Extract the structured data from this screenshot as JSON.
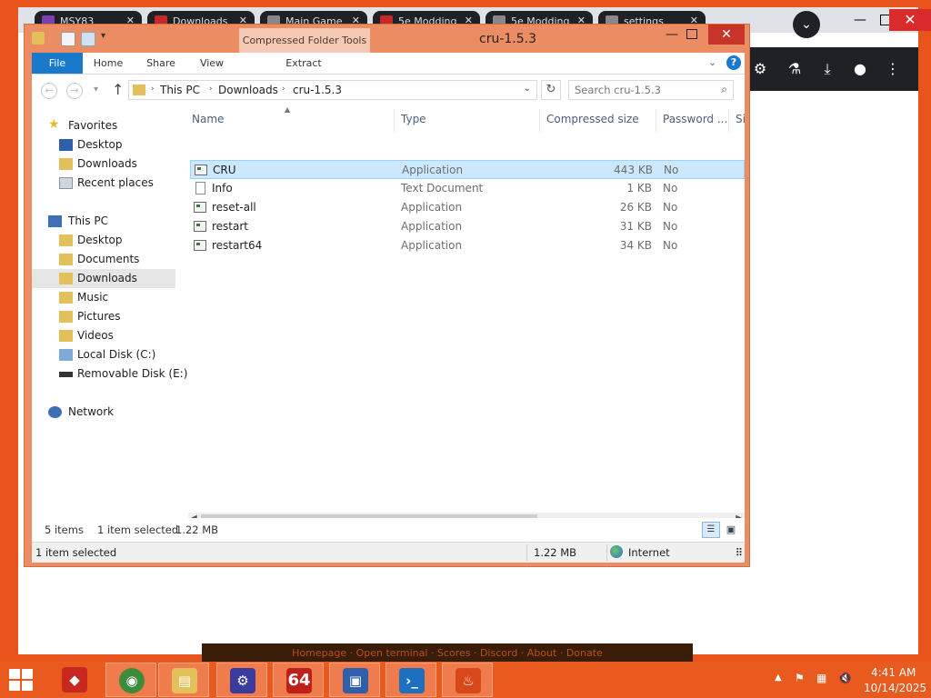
{
  "browser": {
    "tabs": [
      {
        "label": "MSY83",
        "color": "#7b3fb3"
      },
      {
        "label": "Downloads",
        "color": "#c62828"
      },
      {
        "label": "Main Game",
        "color": "#888888"
      },
      {
        "label": "5e Modding",
        "color": "#c62828"
      },
      {
        "label": "5e Modding",
        "color": "#888888"
      },
      {
        "label": "settings",
        "color": "#888888"
      }
    ],
    "link_bar": "Homepage · Open terminal · Scores · Discord · About · Donate"
  },
  "window": {
    "title": "cru-1.5.3",
    "contextual_tab": "Compressed Folder Tools"
  },
  "ribbon": {
    "tabs": [
      "File",
      "Home",
      "Share",
      "View",
      "Extract"
    ]
  },
  "address": {
    "crumbs": [
      "This PC",
      "Downloads",
      "cru-1.5.3"
    ],
    "search_placeholder": "Search cru-1.5.3"
  },
  "nav": {
    "favorites": "Favorites",
    "fav_items": [
      "Desktop",
      "Downloads",
      "Recent places"
    ],
    "this_pc": "This PC",
    "pc_items": [
      "Desktop",
      "Documents",
      "Downloads",
      "Music",
      "Pictures",
      "Videos",
      "Local Disk (C:)",
      "Removable Disk (E:)"
    ],
    "network": "Network",
    "selected": "Downloads"
  },
  "columns": {
    "name": "Name",
    "type": "Type",
    "compressed_size": "Compressed size",
    "password": "Password ...",
    "extra": "Si"
  },
  "files": [
    {
      "name": "CRU",
      "type": "Application",
      "size": "443 KB",
      "password": "No",
      "selected": true
    },
    {
      "name": "Info",
      "type": "Text Document",
      "size": "1 KB",
      "password": "No",
      "selected": false
    },
    {
      "name": "reset-all",
      "type": "Application",
      "size": "26 KB",
      "password": "No",
      "selected": false
    },
    {
      "name": "restart",
      "type": "Application",
      "size": "31 KB",
      "password": "No",
      "selected": false
    },
    {
      "name": "restart64",
      "type": "Application",
      "size": "34 KB",
      "password": "No",
      "selected": false
    }
  ],
  "status": {
    "count": "5 items",
    "selection": "1 item selected",
    "size": "1.22 MB",
    "bottom_selected": "1 item selected",
    "bottom_size": "1.22 MB",
    "zone": "Internet"
  },
  "taskbar": {
    "app64": "64",
    "time": "4:41 AM",
    "date": "10/14/2025"
  },
  "colors": {
    "desktop": "#e8541c",
    "accent": "#1979ca",
    "selection": "#cce8ff",
    "window_frame": "#eb8c63"
  }
}
